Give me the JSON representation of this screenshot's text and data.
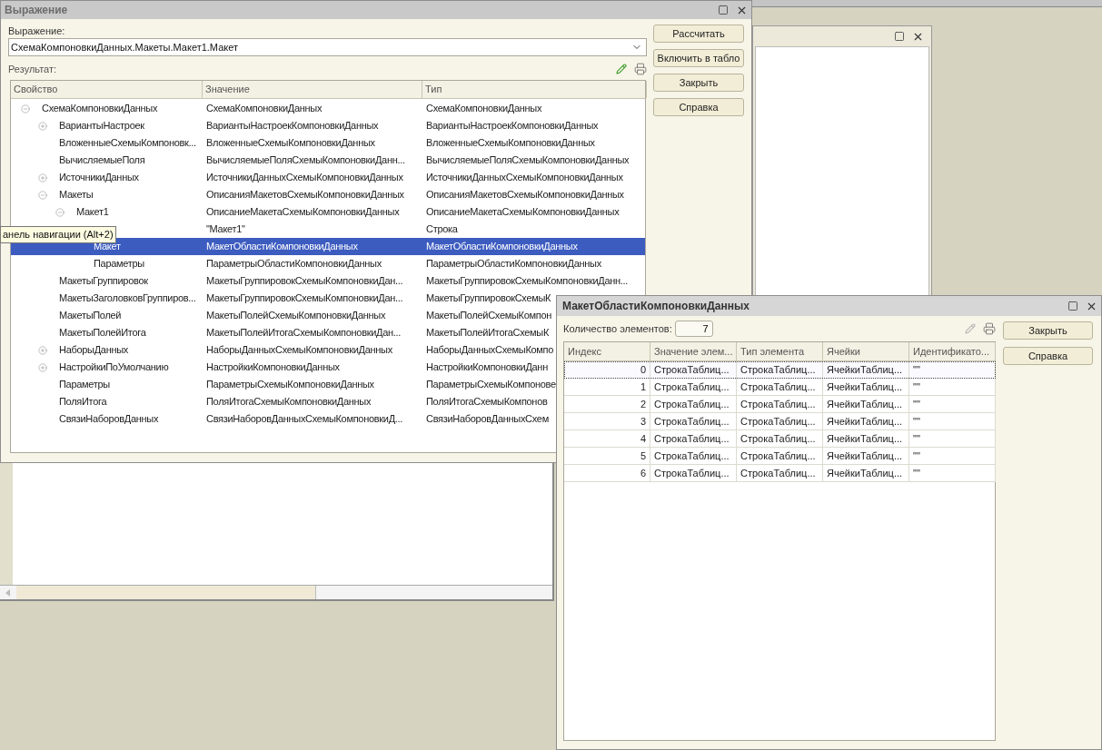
{
  "main_window": {
    "title": "Выражение",
    "expression_label": "Выражение:",
    "expression_value": "СхемаКомпоновкиДанных.Макеты.Макет1.Макет",
    "result_label": "Результат:",
    "edit_disabled": false,
    "buttons": [
      "Рассчитать",
      "Включить в табло",
      "Закрыть",
      "Справка"
    ],
    "tree": {
      "columns": [
        "Свойство",
        "Значение",
        "Тип"
      ],
      "rows": [
        {
          "name": "СхемаКомпоновкиДанных",
          "value": "СхемаКомпоновкиДанных",
          "type": "СхемаКомпоновкиДанных",
          "selected": false,
          "expanded": true,
          "children": [
            {
              "name": "ВариантыНастроек",
              "value": "ВариантыНастроекКомпоновкиДанных",
              "type": "ВариантыНастроекКомпоновкиДанных",
              "selected": false,
              "expanded": false
            },
            {
              "name": "ВложенныеСхемыКомпоновк...",
              "value": "ВложенныеСхемыКомпоновкиДанных",
              "type": "ВложенныеСхемыКомпоновкиДанных",
              "selected": false
            },
            {
              "name": "ВычисляемыеПоля",
              "value": "ВычисляемыеПоляСхемыКомпоновкиДанн...",
              "type": "ВычисляемыеПоляСхемыКомпоновкиДанных",
              "selected": false
            },
            {
              "name": "ИсточникиДанных",
              "value": "ИсточникиДанныхСхемыКомпоновкиДанных",
              "type": "ИсточникиДанныхСхемыКомпоновкиДанных",
              "selected": false,
              "expanded": false
            },
            {
              "name": "Макеты",
              "value": "ОписанияМакетовСхемыКомпоновкиДанных",
              "type": "ОписанияМакетовСхемыКомпоновкиДанных",
              "selected": false,
              "expanded": true,
              "children": [
                {
                  "name": "Макет1",
                  "value": "ОписаниеМакетаСхемыКомпоновкиДанных",
                  "type": "ОписаниеМакетаСхемыКомпоновкиДанных",
                  "selected": false,
                  "expanded": true,
                  "children": [
                    {
                      "value": "\"Макет1\"",
                      "type": "Строка",
                      "selected": false
                    },
                    {
                      "name": "Макет",
                      "value": "МакетОбластиКомпоновкиДанных",
                      "type": "МакетОбластиКомпоновкиДанных",
                      "selected": true
                    },
                    {
                      "name": "Параметры",
                      "value": "ПараметрыОбластиКомпоновкиДанных",
                      "type": "ПараметрыОбластиКомпоновкиДанных",
                      "selected": false
                    }
                  ]
                }
              ]
            },
            {
              "name": "МакетыГруппировок",
              "value": "МакетыГруппировокСхемыКомпоновкиДан...",
              "type": "МакетыГруппировокСхемыКомпоновкиДанн...",
              "selected": false
            },
            {
              "name": "МакетыЗаголовковГруппиров...",
              "value": "МакетыГруппировокСхемыКомпоновкиДан...",
              "type": "МакетыГруппировокСхемыК",
              "selected": false
            },
            {
              "name": "МакетыПолей",
              "value": "МакетыПолейСхемыКомпоновкиДанных",
              "type": "МакетыПолейСхемыКомпон",
              "selected": false
            },
            {
              "name": "МакетыПолейИтога",
              "value": "МакетыПолейИтогаСхемыКомпоновкиДан...",
              "type": "МакетыПолейИтогаСхемыК",
              "selected": false
            },
            {
              "name": "НаборыДанных",
              "value": "НаборыДанныхСхемыКомпоновкиДанных",
              "type": "НаборыДанныхСхемыКомпо",
              "selected": false,
              "expanded": false
            },
            {
              "name": "НастройкиПоУмолчанию",
              "value": "НастройкиКомпоновкиДанных",
              "type": "НастройкиКомпоновкиДанн",
              "selected": false,
              "expanded": false
            },
            {
              "name": "Параметры",
              "value": "ПараметрыСхемыКомпоновкиДанных",
              "type": "ПараметрыСхемыКомпонове",
              "selected": false
            },
            {
              "name": "ПоляИтога",
              "value": "ПоляИтогаСхемыКомпоновкиДанных",
              "type": "ПоляИтогаСхемыКомпонов",
              "selected": false
            },
            {
              "name": "СвязиНаборовДанных",
              "value": "СвязиНаборовДанныхСхемыКомпоновкиД...",
              "type": "СвязиНаборовДанныхСхем",
              "selected": false
            }
          ]
        }
      ]
    }
  },
  "tooltip": {
    "text": "анель навигации (Alt+2)"
  },
  "details_window": {
    "title": "МакетОбластиКомпоновкиДанных",
    "count_label": "Количество элементов:",
    "count_value": "7",
    "edit_disabled": true,
    "buttons": [
      "Закрыть",
      "Справка"
    ],
    "table": {
      "columns": [
        "Индекс",
        "Значение элем...",
        "Тип элемента",
        "Ячейки",
        "Идентификато..."
      ],
      "rows": [
        {
          "cells": [
            "0",
            "СтрокаТаблиц...",
            "СтрокаТаблиц...",
            "ЯчейкиТаблиц...",
            "\"\""
          ],
          "selected": true
        },
        {
          "cells": [
            "1",
            "СтрокаТаблиц...",
            "СтрокаТаблиц...",
            "ЯчейкиТаблиц...",
            "\"\""
          ],
          "selected": false
        },
        {
          "cells": [
            "2",
            "СтрокаТаблиц...",
            "СтрокаТаблиц...",
            "ЯчейкиТаблиц...",
            "\"\""
          ],
          "selected": false
        },
        {
          "cells": [
            "3",
            "СтрокаТаблиц...",
            "СтрокаТаблиц...",
            "ЯчейкиТаблиц...",
            "\"\""
          ],
          "selected": false
        },
        {
          "cells": [
            "4",
            "СтрокаТаблиц...",
            "СтрокаТаблиц...",
            "ЯчейкиТаблиц...",
            "\"\""
          ],
          "selected": false
        },
        {
          "cells": [
            "5",
            "СтрокаТаблиц...",
            "СтрокаТаблиц...",
            "ЯчейкиТаблиц...",
            "\"\""
          ],
          "selected": false
        },
        {
          "cells": [
            "6",
            "СтрокаТаблиц...",
            "СтрокаТаблиц...",
            "ЯчейкиТаблиц...",
            "\"\""
          ],
          "selected": false
        }
      ]
    }
  }
}
